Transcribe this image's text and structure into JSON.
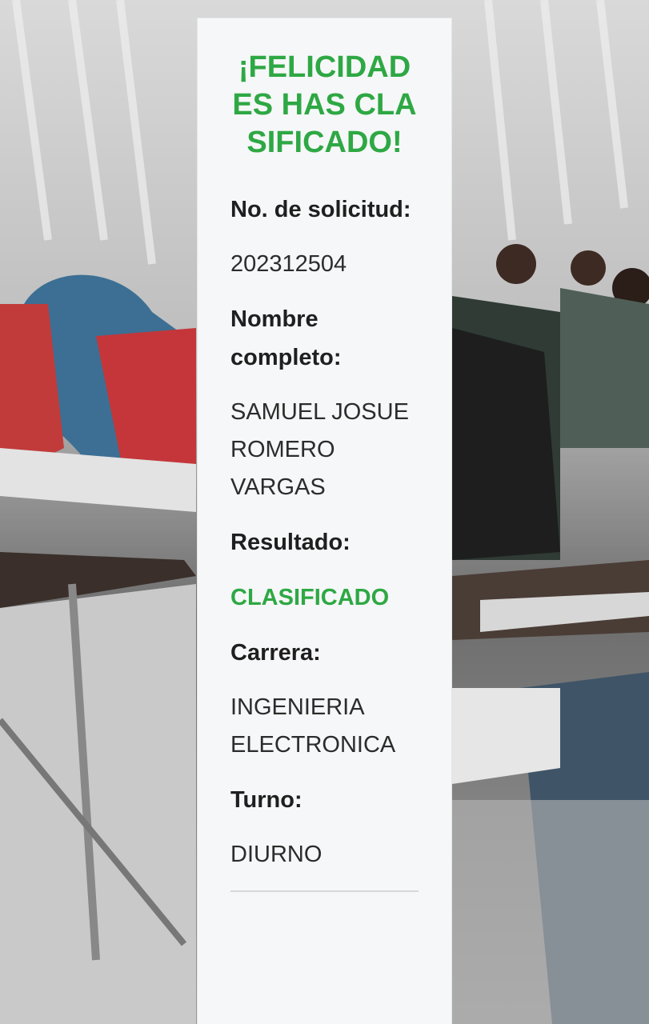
{
  "card": {
    "headline": "¡FELICIDADES HAS CLASIFICADO!",
    "fields": {
      "request_number_label": "No. de solicitud:",
      "request_number_value": "202312504",
      "full_name_label": "Nombre completo:",
      "full_name_value": "SAMUEL JOSUE ROMERO VARGAS",
      "result_label": "Resultado:",
      "result_value": "CLASIFICADO",
      "career_label": "Carrera:",
      "career_value": "INGENIERIA ELECTRONICA",
      "shift_label": "Turno:",
      "shift_value": "DIURNO"
    }
  },
  "colors": {
    "accent_green": "#2ea844",
    "card_background": "#f6f7f8"
  }
}
